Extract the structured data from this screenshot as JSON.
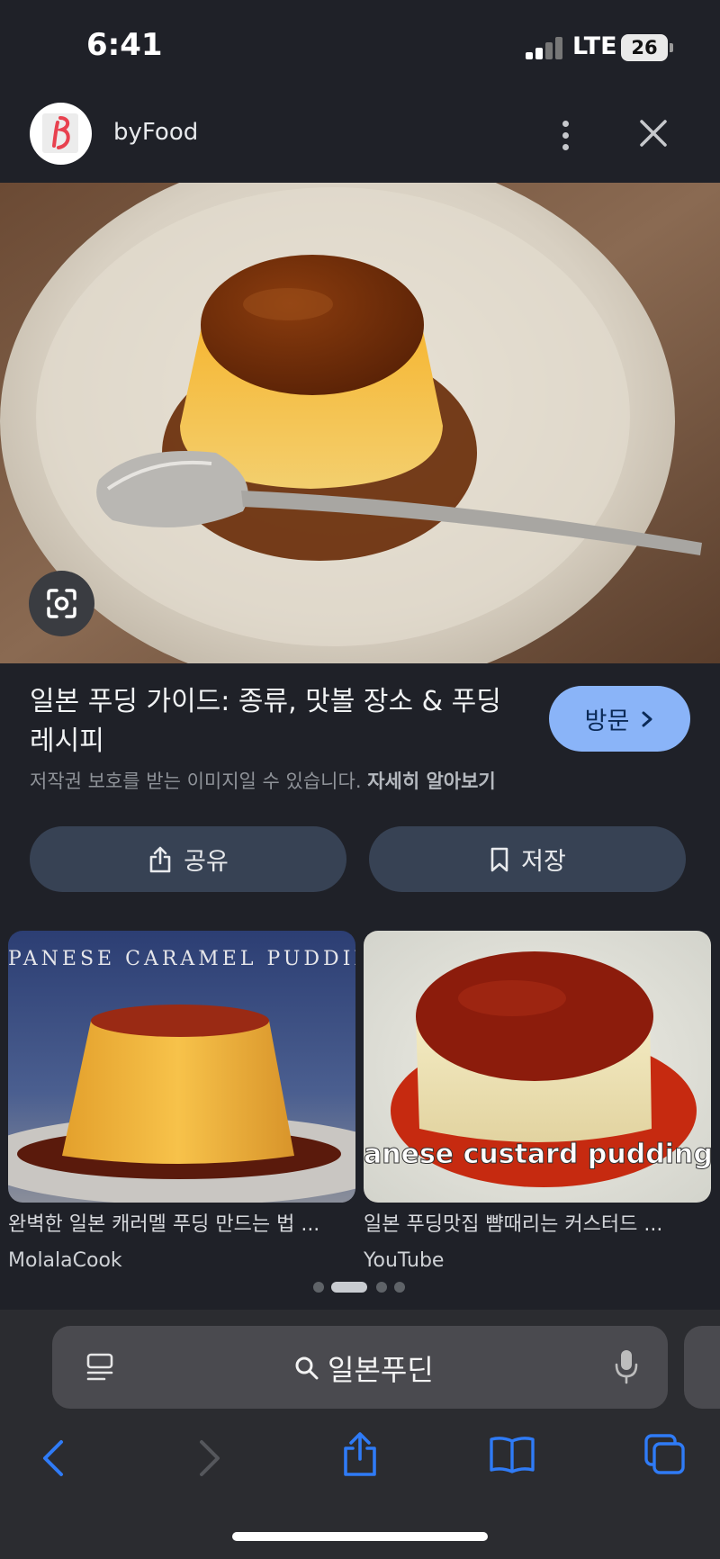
{
  "status_bar": {
    "time": "6:41",
    "network": "LTE",
    "battery": "26"
  },
  "header": {
    "site_name": "byFood",
    "logo_icon": "byfood-logo-icon",
    "more_icon": "more-vertical-icon",
    "close_icon": "close-icon"
  },
  "result": {
    "title": "일본 푸딩 가이드: 종류, 맛볼 장소 & 푸딩 레시피",
    "visit_label": "방문",
    "copyright_note": "저작권 보호를 받는 이미지일 수 있습니다.",
    "learn_more": "자세히 알아보기"
  },
  "actions": {
    "share_label": "공유",
    "save_label": "저장"
  },
  "related": [
    {
      "overlay_text": "PANESE CARAMEL PUDDIN",
      "title": "완벽한 일본 캐러멜 푸딩 만드는 법 ...",
      "source": "MolalaCook"
    },
    {
      "overlay_text": "anese custard pudding",
      "title": "일본 푸딩맛집 뺨때리는 커스터드 ...",
      "source": "YouTube"
    }
  ],
  "pager": {
    "count": 4,
    "active_index": 1
  },
  "address_bar": {
    "query": "일본푸딘"
  },
  "colors": {
    "accent": "#8ab4f8",
    "safari_blue": "#2f7bf6",
    "background": "#1f2128",
    "button_bg": "#374254"
  }
}
